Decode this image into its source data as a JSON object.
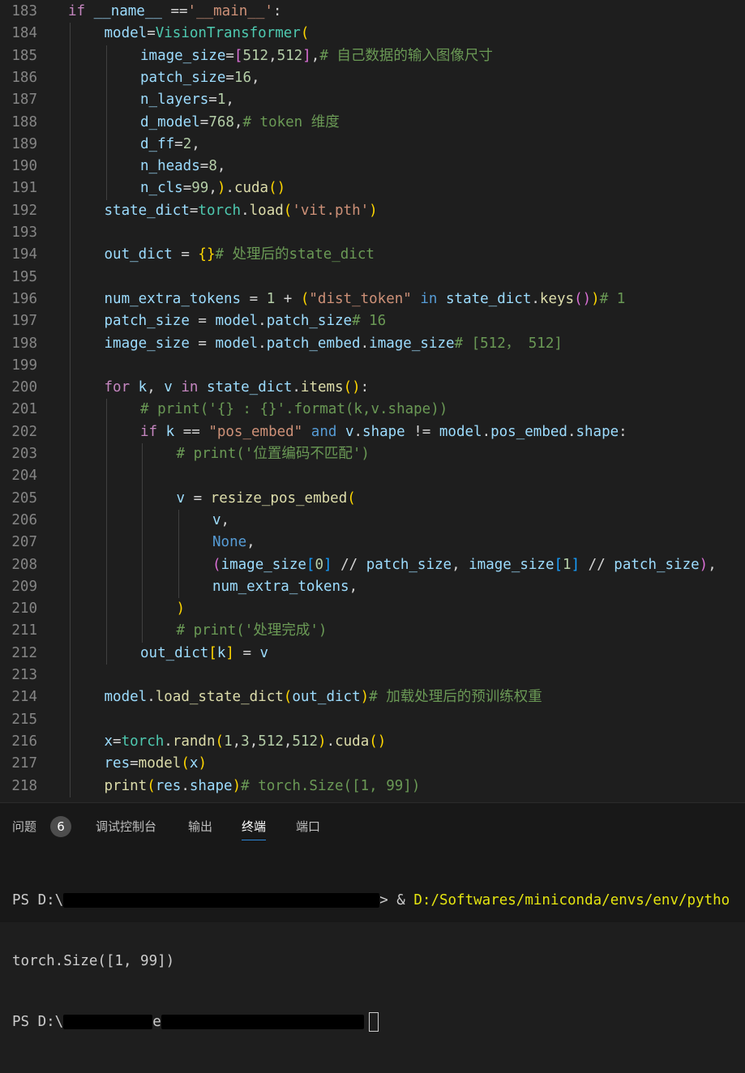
{
  "editor": {
    "lines": [
      {
        "n": "183",
        "ind": 0,
        "t": [
          [
            "if",
            "ctl"
          ],
          [
            " ",
            "op"
          ],
          [
            "__name__",
            "var"
          ],
          [
            " ==",
            "op"
          ],
          [
            "'__main__'",
            "str"
          ],
          [
            ":",
            "op"
          ]
        ]
      },
      {
        "n": "184",
        "ind": 1,
        "t": [
          [
            "model",
            "var"
          ],
          [
            "=",
            "op"
          ],
          [
            "VisionTransformer",
            "cls"
          ],
          [
            "(",
            "b1"
          ]
        ]
      },
      {
        "n": "185",
        "ind": 2,
        "t": [
          [
            "image_size",
            "var"
          ],
          [
            "=",
            "op"
          ],
          [
            "[",
            "b2"
          ],
          [
            "512",
            "num"
          ],
          [
            ",",
            "op"
          ],
          [
            "512",
            "num"
          ],
          [
            "]",
            "b2"
          ],
          [
            ",",
            "op"
          ],
          [
            "# 自己数据的输入图像尺寸",
            "com"
          ]
        ]
      },
      {
        "n": "186",
        "ind": 2,
        "t": [
          [
            "patch_size",
            "var"
          ],
          [
            "=",
            "op"
          ],
          [
            "16",
            "num"
          ],
          [
            ",",
            "op"
          ]
        ]
      },
      {
        "n": "187",
        "ind": 2,
        "t": [
          [
            "n_layers",
            "var"
          ],
          [
            "=",
            "op"
          ],
          [
            "1",
            "num"
          ],
          [
            ",",
            "op"
          ]
        ]
      },
      {
        "n": "188",
        "ind": 2,
        "t": [
          [
            "d_model",
            "var"
          ],
          [
            "=",
            "op"
          ],
          [
            "768",
            "num"
          ],
          [
            ",",
            "op"
          ],
          [
            "# token 维度",
            "com"
          ]
        ]
      },
      {
        "n": "189",
        "ind": 2,
        "t": [
          [
            "d_ff",
            "var"
          ],
          [
            "=",
            "op"
          ],
          [
            "2",
            "num"
          ],
          [
            ",",
            "op"
          ]
        ]
      },
      {
        "n": "190",
        "ind": 2,
        "t": [
          [
            "n_heads",
            "var"
          ],
          [
            "=",
            "op"
          ],
          [
            "8",
            "num"
          ],
          [
            ",",
            "op"
          ]
        ]
      },
      {
        "n": "191",
        "ind": 2,
        "t": [
          [
            "n_cls",
            "var"
          ],
          [
            "=",
            "op"
          ],
          [
            "99",
            "num"
          ],
          [
            ",",
            "op"
          ],
          [
            ")",
            "b1"
          ],
          [
            ".",
            "op"
          ],
          [
            "cuda",
            "fn"
          ],
          [
            "()",
            "b1"
          ]
        ]
      },
      {
        "n": "192",
        "ind": 1,
        "t": [
          [
            "state_dict",
            "var"
          ],
          [
            "=",
            "op"
          ],
          [
            "torch",
            "cls"
          ],
          [
            ".",
            "op"
          ],
          [
            "load",
            "fn"
          ],
          [
            "(",
            "b1"
          ],
          [
            "'vit.pth'",
            "str"
          ],
          [
            ")",
            "b1"
          ]
        ]
      },
      {
        "n": "193",
        "ind": 1,
        "t": []
      },
      {
        "n": "194",
        "ind": 1,
        "t": [
          [
            "out_dict",
            "var"
          ],
          [
            " = ",
            "op"
          ],
          [
            "{}",
            "b1"
          ],
          [
            "# 处理后的state_dict",
            "com"
          ]
        ]
      },
      {
        "n": "195",
        "ind": 1,
        "t": []
      },
      {
        "n": "196",
        "ind": 1,
        "t": [
          [
            "num_extra_tokens",
            "var"
          ],
          [
            " = ",
            "op"
          ],
          [
            "1",
            "num"
          ],
          [
            " + ",
            "op"
          ],
          [
            "(",
            "b1"
          ],
          [
            "\"dist_token\"",
            "str"
          ],
          [
            " ",
            "op"
          ],
          [
            "in",
            "kw"
          ],
          [
            " ",
            "op"
          ],
          [
            "state_dict",
            "var"
          ],
          [
            ".",
            "op"
          ],
          [
            "keys",
            "fn"
          ],
          [
            "()",
            "b2"
          ],
          [
            ")",
            "b1"
          ],
          [
            "# 1",
            "com"
          ]
        ]
      },
      {
        "n": "197",
        "ind": 1,
        "t": [
          [
            "patch_size",
            "var"
          ],
          [
            " = ",
            "op"
          ],
          [
            "model",
            "var"
          ],
          [
            ".",
            "op"
          ],
          [
            "patch_size",
            "var"
          ],
          [
            "# 16",
            "com"
          ]
        ]
      },
      {
        "n": "198",
        "ind": 1,
        "t": [
          [
            "image_size",
            "var"
          ],
          [
            " = ",
            "op"
          ],
          [
            "model",
            "var"
          ],
          [
            ".",
            "op"
          ],
          [
            "patch_embed",
            "var"
          ],
          [
            ".",
            "op"
          ],
          [
            "image_size",
            "var"
          ],
          [
            "# [512， 512]",
            "com"
          ]
        ]
      },
      {
        "n": "199",
        "ind": 1,
        "t": []
      },
      {
        "n": "200",
        "ind": 1,
        "t": [
          [
            "for",
            "ctl"
          ],
          [
            " ",
            "op"
          ],
          [
            "k",
            "var"
          ],
          [
            ", ",
            "op"
          ],
          [
            "v",
            "var"
          ],
          [
            " ",
            "op"
          ],
          [
            "in",
            "ctl"
          ],
          [
            " ",
            "op"
          ],
          [
            "state_dict",
            "var"
          ],
          [
            ".",
            "op"
          ],
          [
            "items",
            "fn"
          ],
          [
            "()",
            "b1"
          ],
          [
            ":",
            "op"
          ]
        ]
      },
      {
        "n": "201",
        "ind": 2,
        "t": [
          [
            "# print('{} : {}'.format(k,v.shape))",
            "com"
          ]
        ]
      },
      {
        "n": "202",
        "ind": 2,
        "t": [
          [
            "if",
            "ctl"
          ],
          [
            " ",
            "op"
          ],
          [
            "k",
            "var"
          ],
          [
            " == ",
            "op"
          ],
          [
            "\"pos_embed\"",
            "str"
          ],
          [
            " ",
            "op"
          ],
          [
            "and",
            "kw"
          ],
          [
            " ",
            "op"
          ],
          [
            "v",
            "var"
          ],
          [
            ".",
            "op"
          ],
          [
            "shape",
            "var"
          ],
          [
            " != ",
            "op"
          ],
          [
            "model",
            "var"
          ],
          [
            ".",
            "op"
          ],
          [
            "pos_embed",
            "var"
          ],
          [
            ".",
            "op"
          ],
          [
            "shape",
            "var"
          ],
          [
            ":",
            "op"
          ]
        ]
      },
      {
        "n": "203",
        "ind": 3,
        "t": [
          [
            "# print('位置编码不匹配')",
            "com"
          ]
        ]
      },
      {
        "n": "204",
        "ind": 3,
        "t": []
      },
      {
        "n": "205",
        "ind": 3,
        "t": [
          [
            "v",
            "var"
          ],
          [
            " = ",
            "op"
          ],
          [
            "resize_pos_embed",
            "fn"
          ],
          [
            "(",
            "b1"
          ]
        ]
      },
      {
        "n": "206",
        "ind": 4,
        "t": [
          [
            "v",
            "var"
          ],
          [
            ",",
            "op"
          ]
        ]
      },
      {
        "n": "207",
        "ind": 4,
        "t": [
          [
            "None",
            "kw"
          ],
          [
            ",",
            "op"
          ]
        ]
      },
      {
        "n": "208",
        "ind": 4,
        "t": [
          [
            "(",
            "b2"
          ],
          [
            "image_size",
            "var"
          ],
          [
            "[",
            "b3"
          ],
          [
            "0",
            "num"
          ],
          [
            "]",
            "b3"
          ],
          [
            " // ",
            "op"
          ],
          [
            "patch_size",
            "var"
          ],
          [
            ", ",
            "op"
          ],
          [
            "image_size",
            "var"
          ],
          [
            "[",
            "b3"
          ],
          [
            "1",
            "num"
          ],
          [
            "]",
            "b3"
          ],
          [
            " // ",
            "op"
          ],
          [
            "patch_size",
            "var"
          ],
          [
            ")",
            "b2"
          ],
          [
            ",",
            "op"
          ]
        ]
      },
      {
        "n": "209",
        "ind": 4,
        "t": [
          [
            "num_extra_tokens",
            "var"
          ],
          [
            ",",
            "op"
          ]
        ]
      },
      {
        "n": "210",
        "ind": 3,
        "t": [
          [
            ")",
            "b1"
          ]
        ]
      },
      {
        "n": "211",
        "ind": 3,
        "t": [
          [
            "# print('处理完成')",
            "com"
          ]
        ]
      },
      {
        "n": "212",
        "ind": 2,
        "t": [
          [
            "out_dict",
            "var"
          ],
          [
            "[",
            "b1"
          ],
          [
            "k",
            "var"
          ],
          [
            "]",
            "b1"
          ],
          [
            " = ",
            "op"
          ],
          [
            "v",
            "var"
          ]
        ]
      },
      {
        "n": "213",
        "ind": 1,
        "t": []
      },
      {
        "n": "214",
        "ind": 1,
        "t": [
          [
            "model",
            "var"
          ],
          [
            ".",
            "op"
          ],
          [
            "load_state_dict",
            "fn"
          ],
          [
            "(",
            "b1"
          ],
          [
            "out_dict",
            "var"
          ],
          [
            ")",
            "b1"
          ],
          [
            "# 加载处理后的预训练权重",
            "com"
          ]
        ]
      },
      {
        "n": "215",
        "ind": 1,
        "t": []
      },
      {
        "n": "216",
        "ind": 1,
        "t": [
          [
            "x",
            "var"
          ],
          [
            "=",
            "op"
          ],
          [
            "torch",
            "cls"
          ],
          [
            ".",
            "op"
          ],
          [
            "randn",
            "fn"
          ],
          [
            "(",
            "b1"
          ],
          [
            "1",
            "num"
          ],
          [
            ",",
            "op"
          ],
          [
            "3",
            "num"
          ],
          [
            ",",
            "op"
          ],
          [
            "512",
            "num"
          ],
          [
            ",",
            "op"
          ],
          [
            "512",
            "num"
          ],
          [
            ")",
            "b1"
          ],
          [
            ".",
            "op"
          ],
          [
            "cuda",
            "fn"
          ],
          [
            "()",
            "b1"
          ]
        ]
      },
      {
        "n": "217",
        "ind": 1,
        "t": [
          [
            "res",
            "var"
          ],
          [
            "=",
            "op"
          ],
          [
            "model",
            "fn"
          ],
          [
            "(",
            "b1"
          ],
          [
            "x",
            "var"
          ],
          [
            ")",
            "b1"
          ]
        ]
      },
      {
        "n": "218",
        "ind": 1,
        "t": [
          [
            "print",
            "fn"
          ],
          [
            "(",
            "b1"
          ],
          [
            "res",
            "var"
          ],
          [
            ".",
            "op"
          ],
          [
            "shape",
            "var"
          ],
          [
            ")",
            "b1"
          ],
          [
            "# torch.Size([1, 99])",
            "com"
          ]
        ]
      }
    ]
  },
  "panel": {
    "tabs": [
      {
        "label": "问题",
        "name": "tab-problems"
      },
      {
        "label": "调试控制台",
        "name": "tab-debug-console"
      },
      {
        "label": "输出",
        "name": "tab-output"
      },
      {
        "label": "终端",
        "name": "tab-terminal"
      },
      {
        "label": "端口",
        "name": "tab-ports"
      }
    ],
    "problems_count": "6",
    "active_tab": "终端"
  },
  "terminal": {
    "line1_prefix": "PS D:\\",
    "line1_arrow": ">",
    "line1_amp": " & ",
    "line1_path": "D:/Softwares/miniconda/envs/env/pytho",
    "line2": "torch.Size([1, 99])",
    "line3_prefix": "PS D:\\",
    "line3_fragment": "e"
  }
}
